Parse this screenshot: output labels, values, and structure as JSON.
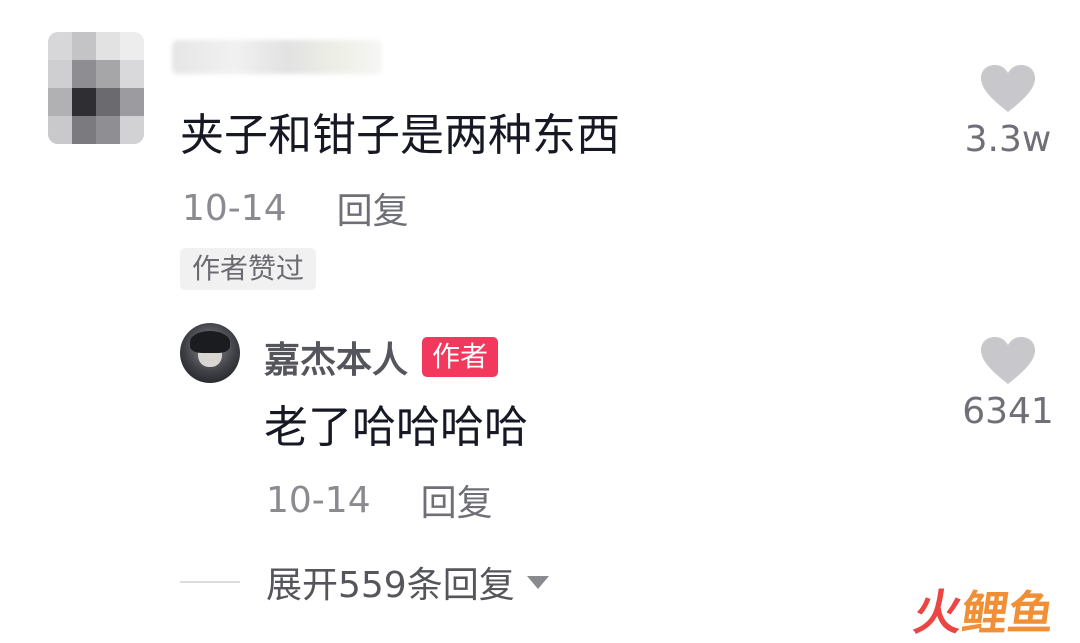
{
  "comment": {
    "text": "夹子和钳子是两种东西",
    "date": "10-14",
    "reply_label": "回复",
    "liked_badge": "作者赞过",
    "like_count": "3.3w"
  },
  "reply": {
    "username": "嘉杰本人",
    "author_badge": "作者",
    "text": "老了哈哈哈哈",
    "date": "10-14",
    "reply_label": "回复",
    "like_count": "6341"
  },
  "expand": {
    "label": "展开559条回复"
  },
  "watermark": {
    "part1": "火",
    "part2": "鲤鱼"
  },
  "colors": {
    "text_primary": "#161823",
    "text_secondary": "#8a8b91",
    "author_badge_bg": "#f2385c",
    "heart_icon": "#c8c8cc",
    "watermark_red": "#e93d3a",
    "watermark_orange": "#f08a2c"
  },
  "icons": {
    "like": "heart-icon",
    "expand": "caret-down-icon"
  }
}
